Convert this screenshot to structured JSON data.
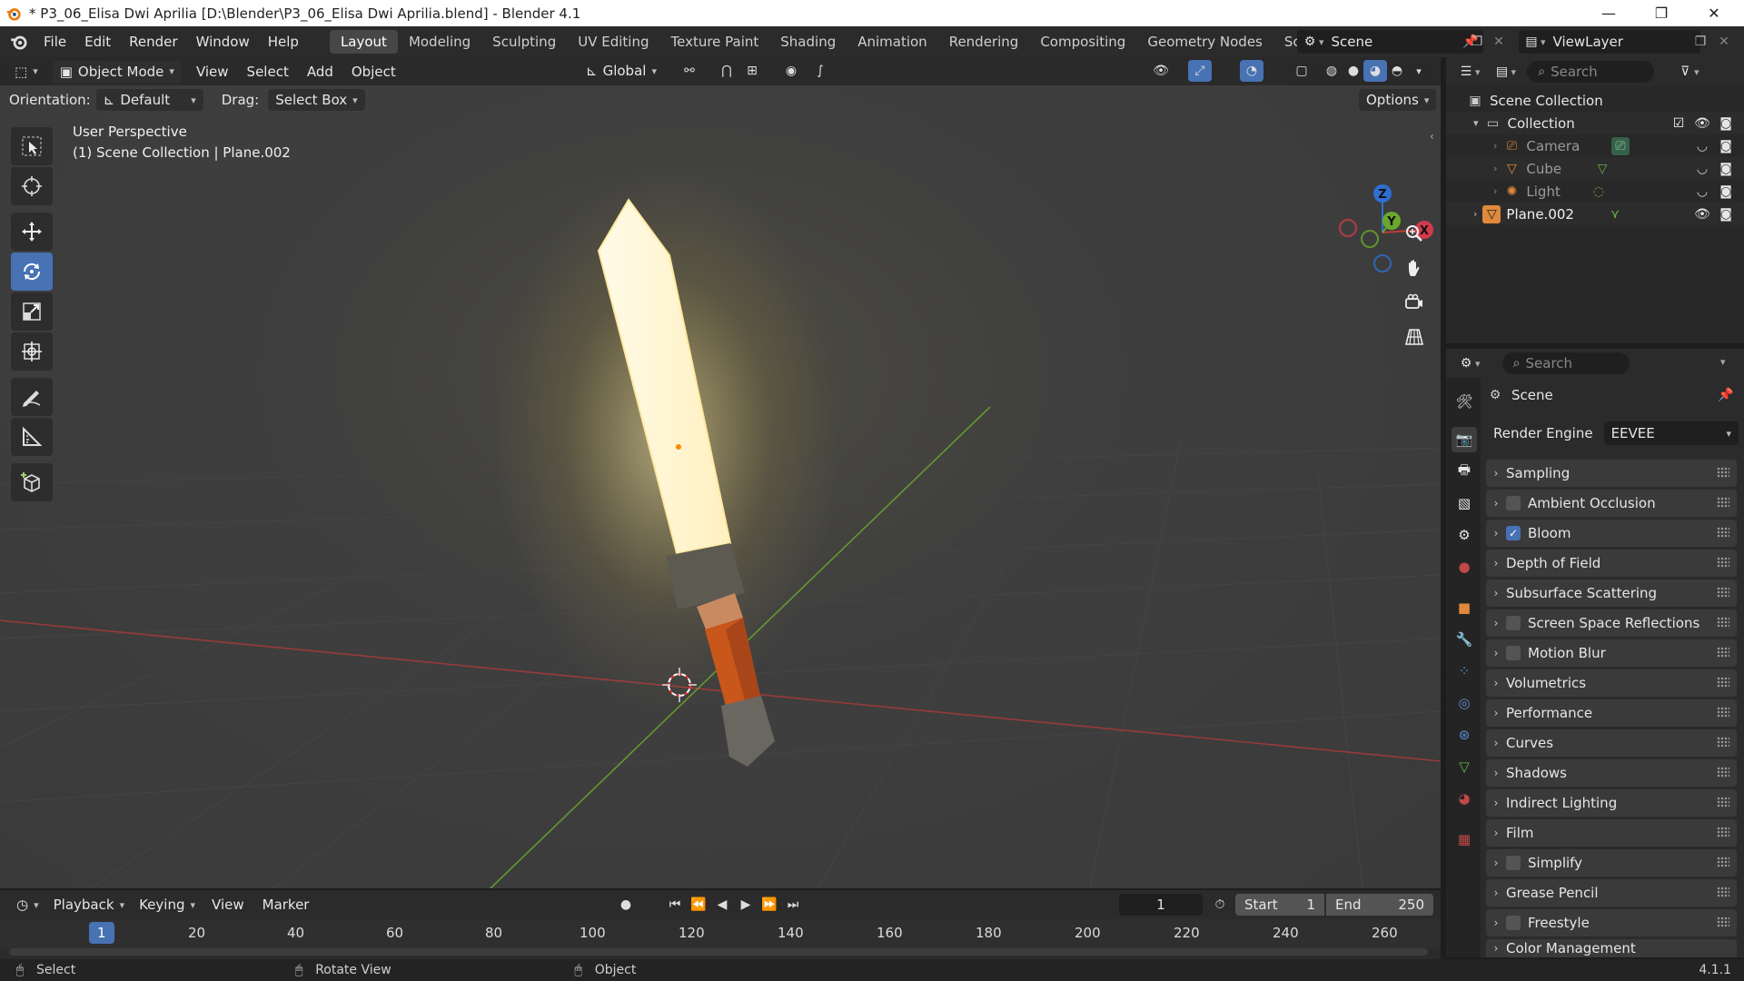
{
  "window": {
    "title": "* P3_06_Elisa Dwi Aprilia [D:\\Blender\\P3_06_Elisa Dwi Aprilia.blend] - Blender 4.1",
    "minimize": "—",
    "maximize": "❐",
    "close": "✕"
  },
  "menu": {
    "items": [
      "File",
      "Edit",
      "Render",
      "Window",
      "Help"
    ],
    "workspaces": [
      "Layout",
      "Modeling",
      "Sculpting",
      "UV Editing",
      "Texture Paint",
      "Shading",
      "Animation",
      "Rendering",
      "Compositing",
      "Geometry Nodes",
      "Scripting"
    ],
    "active_workspace": "Layout",
    "add_tab": "+",
    "scene_name": "Scene",
    "view_layer": "ViewLayer"
  },
  "viewport": {
    "mode": "Object Mode",
    "menus": [
      "View",
      "Select",
      "Add",
      "Object"
    ],
    "transform": "Global",
    "orientation_label": "Orientation:",
    "orientation_value": "Default",
    "drag_label": "Drag:",
    "drag_value": "Select Box",
    "options": "Options",
    "overlay_line1": "User Perspective",
    "overlay_line2": "(1) Scene Collection | Plane.002",
    "gizmo_x": "X",
    "gizmo_y": "Y",
    "gizmo_z": "Z"
  },
  "outliner": {
    "search_placeholder": "Search",
    "root": "Scene Collection",
    "items": [
      {
        "name": "Collection"
      },
      {
        "name": "Camera"
      },
      {
        "name": "Cube"
      },
      {
        "name": "Light"
      },
      {
        "name": "Plane.002"
      }
    ]
  },
  "properties": {
    "search_placeholder": "Search",
    "context": "Scene",
    "render_engine_label": "Render Engine",
    "render_engine_value": "EEVEE",
    "panels": [
      {
        "label": "Sampling",
        "checkbox": null
      },
      {
        "label": "Ambient Occlusion",
        "checkbox": false
      },
      {
        "label": "Bloom",
        "checkbox": true
      },
      {
        "label": "Depth of Field",
        "checkbox": null
      },
      {
        "label": "Subsurface Scattering",
        "checkbox": null
      },
      {
        "label": "Screen Space Reflections",
        "checkbox": false
      },
      {
        "label": "Motion Blur",
        "checkbox": false
      },
      {
        "label": "Volumetrics",
        "checkbox": null
      },
      {
        "label": "Performance",
        "checkbox": null
      },
      {
        "label": "Curves",
        "checkbox": null
      },
      {
        "label": "Shadows",
        "checkbox": null
      },
      {
        "label": "Indirect Lighting",
        "checkbox": null
      },
      {
        "label": "Film",
        "checkbox": null
      },
      {
        "label": "Simplify",
        "checkbox": false
      },
      {
        "label": "Grease Pencil",
        "checkbox": null
      },
      {
        "label": "Freestyle",
        "checkbox": false
      },
      {
        "label": "Color Management",
        "checkbox": null
      }
    ]
  },
  "timeline": {
    "menus": [
      "Playback",
      "Keying",
      "View",
      "Marker"
    ],
    "current_frame": "1",
    "start_label": "Start",
    "start_value": "1",
    "end_label": "End",
    "end_value": "250",
    "ruler": [
      "1",
      "20",
      "40",
      "60",
      "80",
      "100",
      "120",
      "140",
      "160",
      "180",
      "200",
      "220",
      "240",
      "260"
    ]
  },
  "statusbar": {
    "items": [
      "Select",
      "Rotate View",
      "Object"
    ],
    "version": "4.1.1"
  },
  "colors": {
    "accent": "#4772b3",
    "blade_glow": "#fff3c4",
    "handle": "#cf5f1e",
    "axis_x": "#c13a3a",
    "axis_y": "#6aa72c"
  }
}
